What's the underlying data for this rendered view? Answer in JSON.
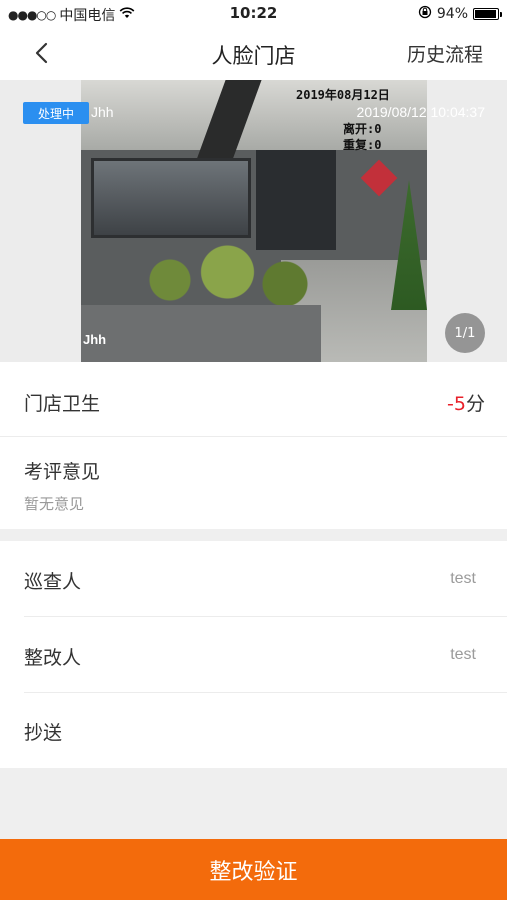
{
  "status_bar": {
    "signal": "●●●○○",
    "carrier": "中国电信",
    "time": "10:22",
    "battery_percent_text": "94%",
    "battery_level": 0.94
  },
  "nav": {
    "title": "人脸门店",
    "history_label": "历史流程"
  },
  "photo": {
    "status_badge": "处理中",
    "author": "Jhh",
    "timestamp": "2019/08/12 10:04:37",
    "overlay_date": "2019年08月12日",
    "overlay_leave": "离开:0",
    "overlay_repeat": "重复:0",
    "overlay_author": "Jhh",
    "page_counter": "1/1"
  },
  "score": {
    "label": "门店卫生",
    "value": "-5",
    "unit": "分"
  },
  "comment": {
    "label": "考评意见",
    "value": "暂无意见"
  },
  "people": {
    "inspector_label": "巡查人",
    "inspector_value": "test",
    "rectifier_label": "整改人",
    "rectifier_value": "test",
    "cc_label": "抄送"
  },
  "actions": {
    "verify_label": "整改验证"
  },
  "colors": {
    "accent_orange": "#f36b0c",
    "badge_blue": "#2b8ff0",
    "negative_red": "#e8202a"
  }
}
